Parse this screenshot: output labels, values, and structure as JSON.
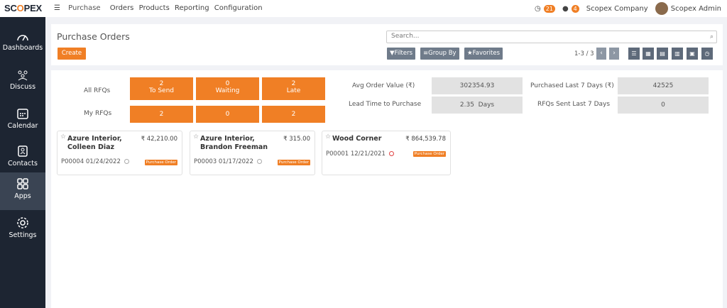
{
  "brand": {
    "logo_pre": "SC",
    "logo_o": "O",
    "logo_post": "PEX"
  },
  "topbar": {
    "app_name": "Purchase",
    "menu": [
      "Orders",
      "Products",
      "Reporting",
      "Configuration"
    ],
    "activity_count": "21",
    "message_count": "4",
    "company": "Scopex Company",
    "user": "Scopex Admin"
  },
  "sidebar": {
    "items": [
      {
        "label": "Dashboards",
        "icon": "gauge-icon"
      },
      {
        "label": "Discuss",
        "icon": "discuss-icon"
      },
      {
        "label": "Calendar",
        "icon": "calendar-icon"
      },
      {
        "label": "Contacts",
        "icon": "contacts-icon"
      },
      {
        "label": "Apps",
        "icon": "apps-icon"
      },
      {
        "label": "Settings",
        "icon": "gear-icon"
      }
    ]
  },
  "control": {
    "title": "Purchase Orders",
    "create_label": "Create",
    "search_placeholder": "Search...",
    "filters_label": "Filters",
    "groupby_label": "Group By",
    "favorites_label": "Favorites",
    "pager": "1-3 / 3"
  },
  "dashboard": {
    "row_labels": [
      "All RFQs",
      "My RFQs"
    ],
    "all_rfqs": [
      {
        "count": "2",
        "label": "To Send"
      },
      {
        "count": "0",
        "label": "Waiting"
      },
      {
        "count": "2",
        "label": "Late"
      }
    ],
    "my_rfqs": [
      "2",
      "0",
      "2"
    ],
    "stats": {
      "avg_order_value_label": "Avg Order Value (₹)",
      "avg_order_value": "302354.93",
      "lead_time_label": "Lead Time to Purchase",
      "lead_time": "2.35  Days",
      "purchased_last7_label": "Purchased Last 7 Days (₹)",
      "purchased_last7": "42525",
      "rfqs_sent_label": "RFQs Sent Last 7 Days",
      "rfqs_sent": "0"
    }
  },
  "cards": [
    {
      "name": "Azure Interior, Colleen Diaz",
      "amount": "₹ 42,210.00",
      "ref": "P00004 01/24/2022",
      "tag": "Purchase Order"
    },
    {
      "name": "Azure Interior, Brandon Freeman",
      "amount": "₹ 315.00",
      "ref": "P00003 01/17/2022",
      "tag": "Purchase Order"
    },
    {
      "name": "Wood Corner",
      "amount": "₹ 864,539.78",
      "ref": "P00001 12/21/2021",
      "tag": "Purchase Order"
    }
  ],
  "colors": {
    "accent": "#f07f25",
    "sidebar": "#1d2532",
    "button_grey": "#6f7b8a"
  }
}
